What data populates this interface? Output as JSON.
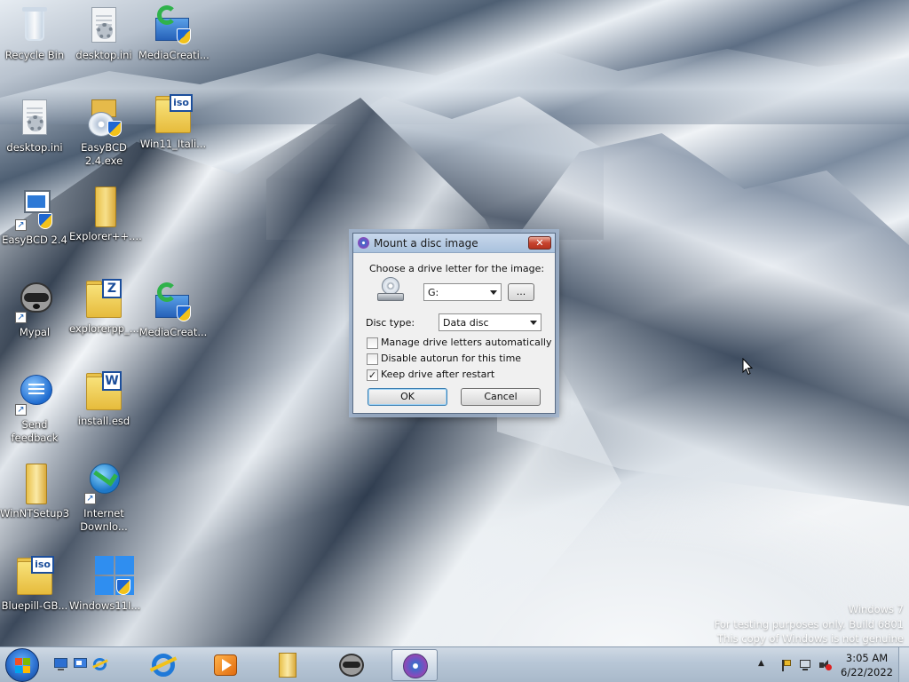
{
  "desktop": {
    "icons": [
      {
        "label": "Recycle Bin"
      },
      {
        "label": "desktop.ini"
      },
      {
        "label": "MediaCreati..."
      },
      {
        "label": "desktop.ini"
      },
      {
        "label": "EasyBCD 2.4.exe"
      },
      {
        "label": "Win11_Itali..."
      },
      {
        "label": "EasyBCD 2.4"
      },
      {
        "label": "Explorer++...."
      },
      {
        "label": "Mypal"
      },
      {
        "label": "explorerpp_..."
      },
      {
        "label": "MediaCreat..."
      },
      {
        "label": "Send feedback"
      },
      {
        "label": "install.esd"
      },
      {
        "label": "WinNTSetup3"
      },
      {
        "label": "Internet Downlo..."
      },
      {
        "label": "Bluepill-GB..."
      },
      {
        "label": "Windows11I..."
      }
    ],
    "badges": {
      "iso": "iso",
      "zip": "Z",
      "word": "W"
    }
  },
  "dialog": {
    "title": "Mount a disc image",
    "close": "✕",
    "choose_label": "Choose a drive letter for the image:",
    "drive_value": "G:",
    "browse_label": "...",
    "disc_type_label": "Disc type:",
    "disc_type_value": "Data disc",
    "options": [
      {
        "label": "Manage drive letters automatically",
        "checked": false
      },
      {
        "label": "Disable autorun for this time",
        "checked": false
      },
      {
        "label": "Keep drive after restart",
        "checked": true
      }
    ],
    "ok_label": "OK",
    "cancel_label": "Cancel"
  },
  "watermark": {
    "line1": "Windows 7",
    "line2": "For testing purposes only. Build 6801",
    "line3": "This copy of Windows is not genuine"
  },
  "taskbar": {
    "time": "3:05 AM",
    "date": "6/22/2022",
    "tray_expand": "▲"
  }
}
